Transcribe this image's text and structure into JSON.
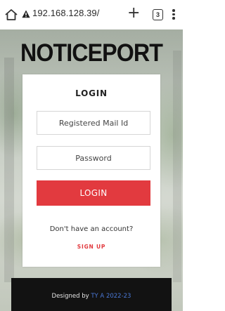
{
  "browser": {
    "url": "192.168.128.39/",
    "tab_count": "3",
    "icons": [
      "home-icon",
      "warning-icon",
      "plus-icon",
      "menu-icon"
    ]
  },
  "brand": {
    "title": "NOTICEPORT"
  },
  "login": {
    "title": "LOGIN",
    "email_placeholder": "Registered Mail Id",
    "password_placeholder": "Password",
    "login_button": "LOGIN",
    "no_account_text": "Don't have an account?",
    "signup_link": "SIGN UP"
  },
  "footer": {
    "designed_by": "Designed by",
    "credit": "TY A 2022-23"
  },
  "colors": {
    "accent": "#e23a3f",
    "footer_bg": "#121212",
    "credit_link": "#4a78d6"
  }
}
